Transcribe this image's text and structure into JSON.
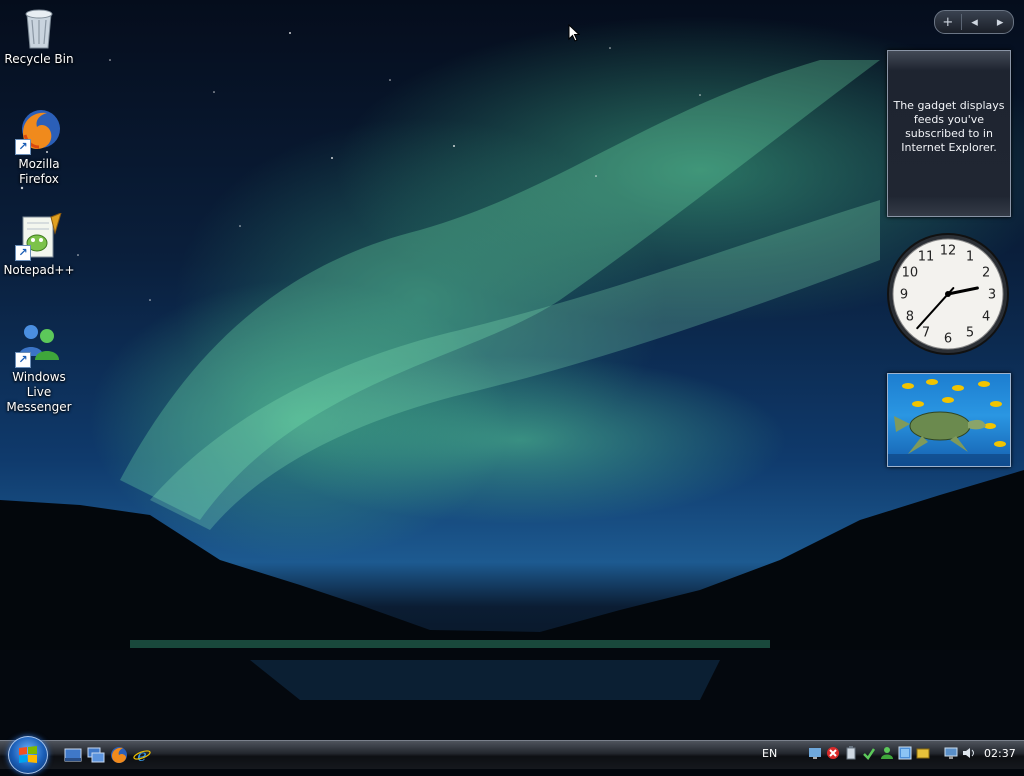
{
  "desktop": {
    "icons": [
      {
        "label": "Recycle Bin",
        "icon": "recycle-bin-icon"
      },
      {
        "label": "Mozilla Firefox",
        "icon": "firefox-icon"
      },
      {
        "label": "Notepad++",
        "icon": "notepad-plus-plus-icon"
      },
      {
        "label": "Windows Live Messenger",
        "icon": "messenger-icon"
      }
    ]
  },
  "sidebar": {
    "controls": {
      "add": "+",
      "prev": "◂",
      "next": "▸"
    },
    "feed_gadget": {
      "text": "The gadget displays feeds you've subscribed to in Internet Explorer."
    },
    "clock_gadget": {
      "numbers": [
        "12",
        "1",
        "2",
        "3",
        "4",
        "5",
        "6",
        "7",
        "8",
        "9",
        "10",
        "11"
      ],
      "time": "02:37"
    },
    "slideshow_gadget": {
      "subject": "sea turtle with fish"
    }
  },
  "taskbar": {
    "start_icon": "windows-logo-icon",
    "quick_launch": [
      "show-desktop-icon",
      "switch-windows-icon",
      "firefox-icon",
      "internet-explorer-icon"
    ],
    "language": "EN",
    "tray_icons": [
      "network-icon",
      "security-alert-icon",
      "battery-icon",
      "update-icon",
      "messenger-status-icon",
      "display-icon",
      "notification-icon",
      "speaker-icon"
    ],
    "clock": "02:37"
  },
  "colors": {
    "aurora": "#5fd49a",
    "sky": "#0f3a6c",
    "taskbar": "#15181d",
    "start_orb": "#1b5fb8"
  }
}
